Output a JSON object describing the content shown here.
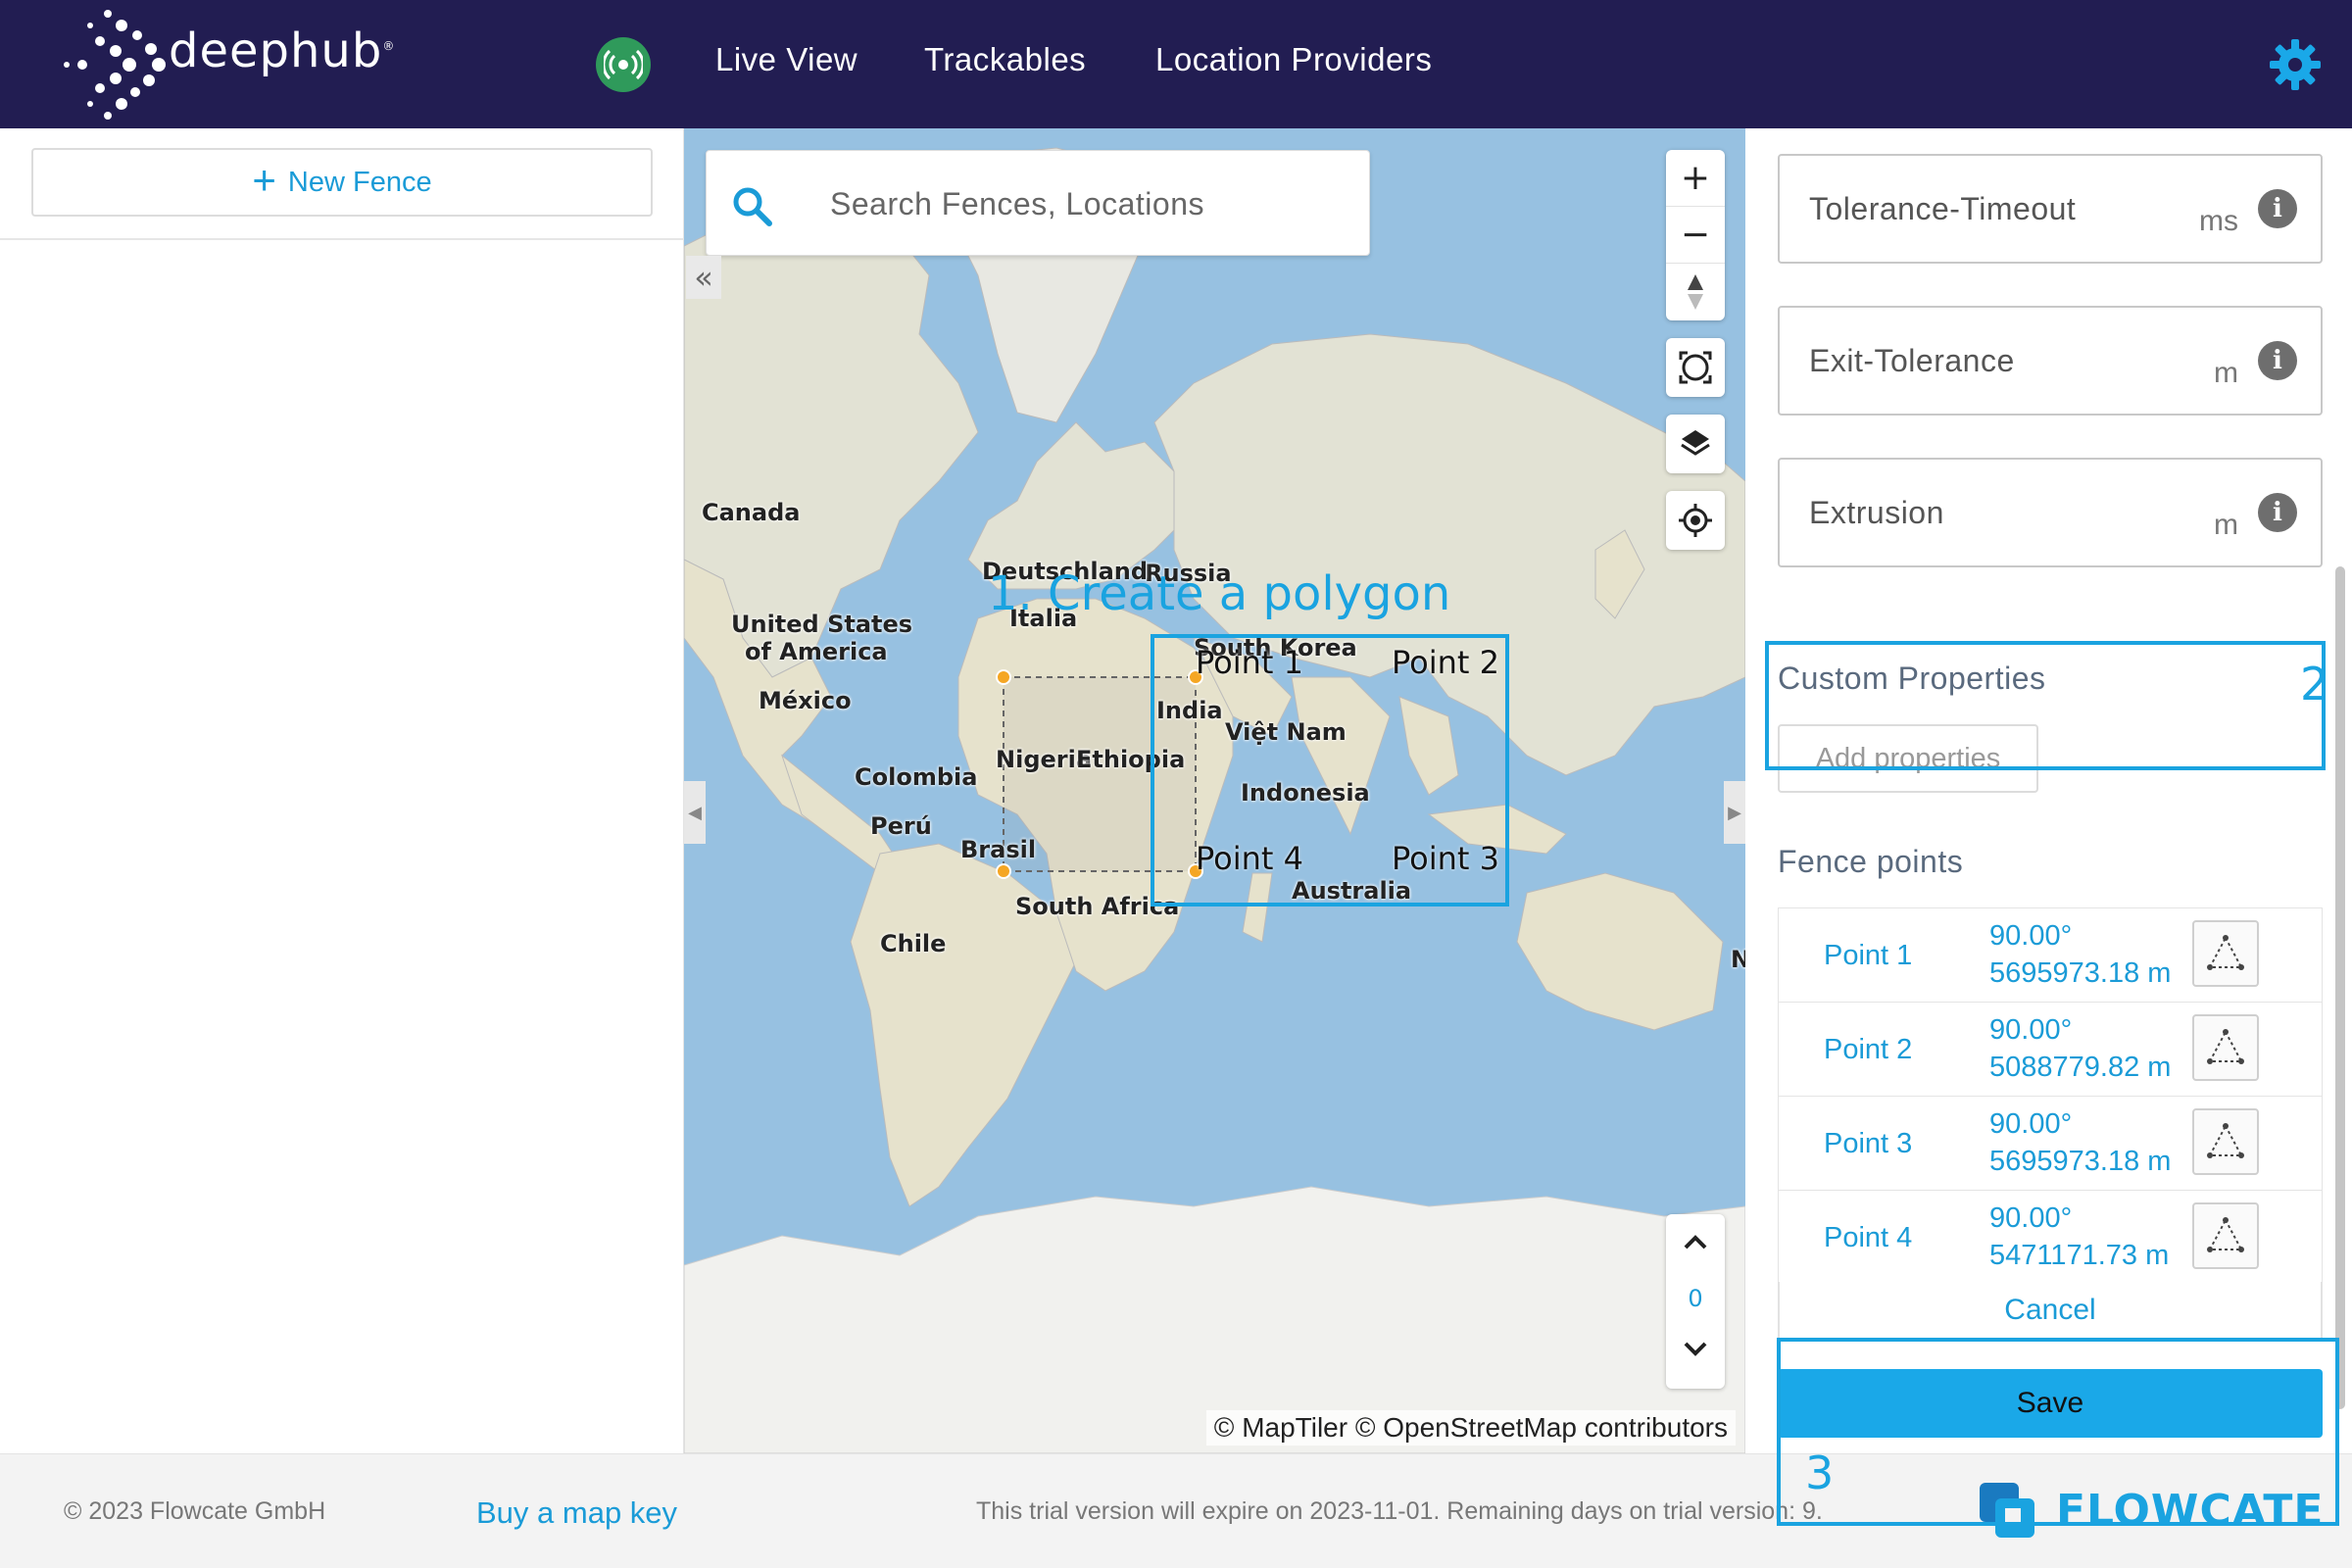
{
  "header": {
    "brand": "deephub",
    "brand_mark": "®",
    "nav": [
      "Live View",
      "Trackables",
      "Location Providers"
    ],
    "status_icon": "broadcast-icon",
    "settings_icon": "gear-icon",
    "colors": {
      "background": "#221d52",
      "status_online": "#2f9a5b",
      "accent": "#1aa3e0"
    }
  },
  "sidebar": {
    "new_fence_label": "New Fence"
  },
  "map": {
    "search_placeholder": "Search Fences, Locations",
    "zoom_in": "+",
    "zoom_out": "−",
    "level_value": "0",
    "attribution": "© MapTiler © OpenStreetMap contributors",
    "labels": {
      "canada": "Canada",
      "united_states_1": "United States",
      "united_states_2": "of America",
      "mexico": "México",
      "colombia": "Colombia",
      "peru": "Perú",
      "brasil": "Brasil",
      "chile": "Chile",
      "deutschland": "Deutschland",
      "italia": "Italia",
      "russia": "Russia",
      "south_korea": "South Korea",
      "india": "India",
      "viet_nam": "Việt Nam",
      "indonesia": "Indonesia",
      "australia": "Australia",
      "nigeria": "Nigeria",
      "ethiopia": "Ethiopia",
      "south_africa": "South Africa",
      "edge_letter": "N"
    },
    "polygon_points": [
      "Point 1",
      "Point 2",
      "Point 3",
      "Point 4"
    ],
    "annotation_1": "1. Create a polygon"
  },
  "panel": {
    "fields": [
      {
        "label": "Tolerance-Timeout",
        "unit": "ms"
      },
      {
        "label": "Exit-Tolerance",
        "unit": "m"
      },
      {
        "label": "Extrusion",
        "unit": "m"
      }
    ],
    "custom_properties_title": "Custom Properties",
    "add_properties_label": "Add properties",
    "annotation_2": "2",
    "fence_points_title": "Fence points",
    "points": [
      {
        "name": "Point 1",
        "angle": "90.00°",
        "distance": "5695973.18 m"
      },
      {
        "name": "Point 2",
        "angle": "90.00°",
        "distance": "5088779.82 m"
      },
      {
        "name": "Point 3",
        "angle": "90.00°",
        "distance": "5695973.18 m"
      },
      {
        "name": "Point 4",
        "angle": "90.00°",
        "distance": "5471171.73 m"
      }
    ],
    "cancel_label": "Cancel",
    "save_label": "Save",
    "annotation_3": "3"
  },
  "footer": {
    "copyright": "© 2023 Flowcate GmbH",
    "buy_map_key": "Buy a map key",
    "trial_notice": "This trial version will expire on 2023-11-01. Remaining days on trial version: 9.",
    "flowcate_brand": "FLOWCATE"
  }
}
